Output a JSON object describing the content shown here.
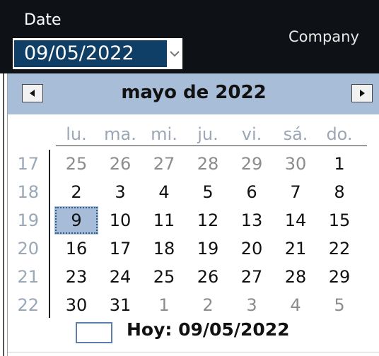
{
  "header": {
    "date_label": "Date",
    "company_label": "Company",
    "date_value": "09/05/2022"
  },
  "calendar": {
    "title": "mayo de 2022",
    "weekdays": [
      "lu.",
      "ma.",
      "mi.",
      "ju.",
      "vi.",
      "sá.",
      "do."
    ],
    "weeks": [
      {
        "num": "17",
        "days": [
          "25",
          "26",
          "27",
          "28",
          "29",
          "30",
          "1"
        ]
      },
      {
        "num": "18",
        "days": [
          "2",
          "3",
          "4",
          "5",
          "6",
          "7",
          "8"
        ]
      },
      {
        "num": "19",
        "days": [
          "9",
          "10",
          "11",
          "12",
          "13",
          "14",
          "15"
        ]
      },
      {
        "num": "20",
        "days": [
          "16",
          "17",
          "18",
          "19",
          "20",
          "21",
          "22"
        ]
      },
      {
        "num": "21",
        "days": [
          "23",
          "24",
          "25",
          "26",
          "27",
          "28",
          "29"
        ]
      },
      {
        "num": "22",
        "days": [
          "30",
          "31",
          "1",
          "2",
          "3",
          "4",
          "5"
        ]
      }
    ],
    "selected_day": "9",
    "today_text": "Hoy: 09/05/2022"
  },
  "colors": {
    "header_bg": "#a8bdd7",
    "selected_bg": "#a7bcd8",
    "date_value_bg": "#0f3e66",
    "muted_text": "#9aa7b7"
  },
  "icons": {
    "prev": "triangle-left-icon",
    "next": "triangle-right-icon",
    "dropdown": "chevron-down-icon"
  }
}
